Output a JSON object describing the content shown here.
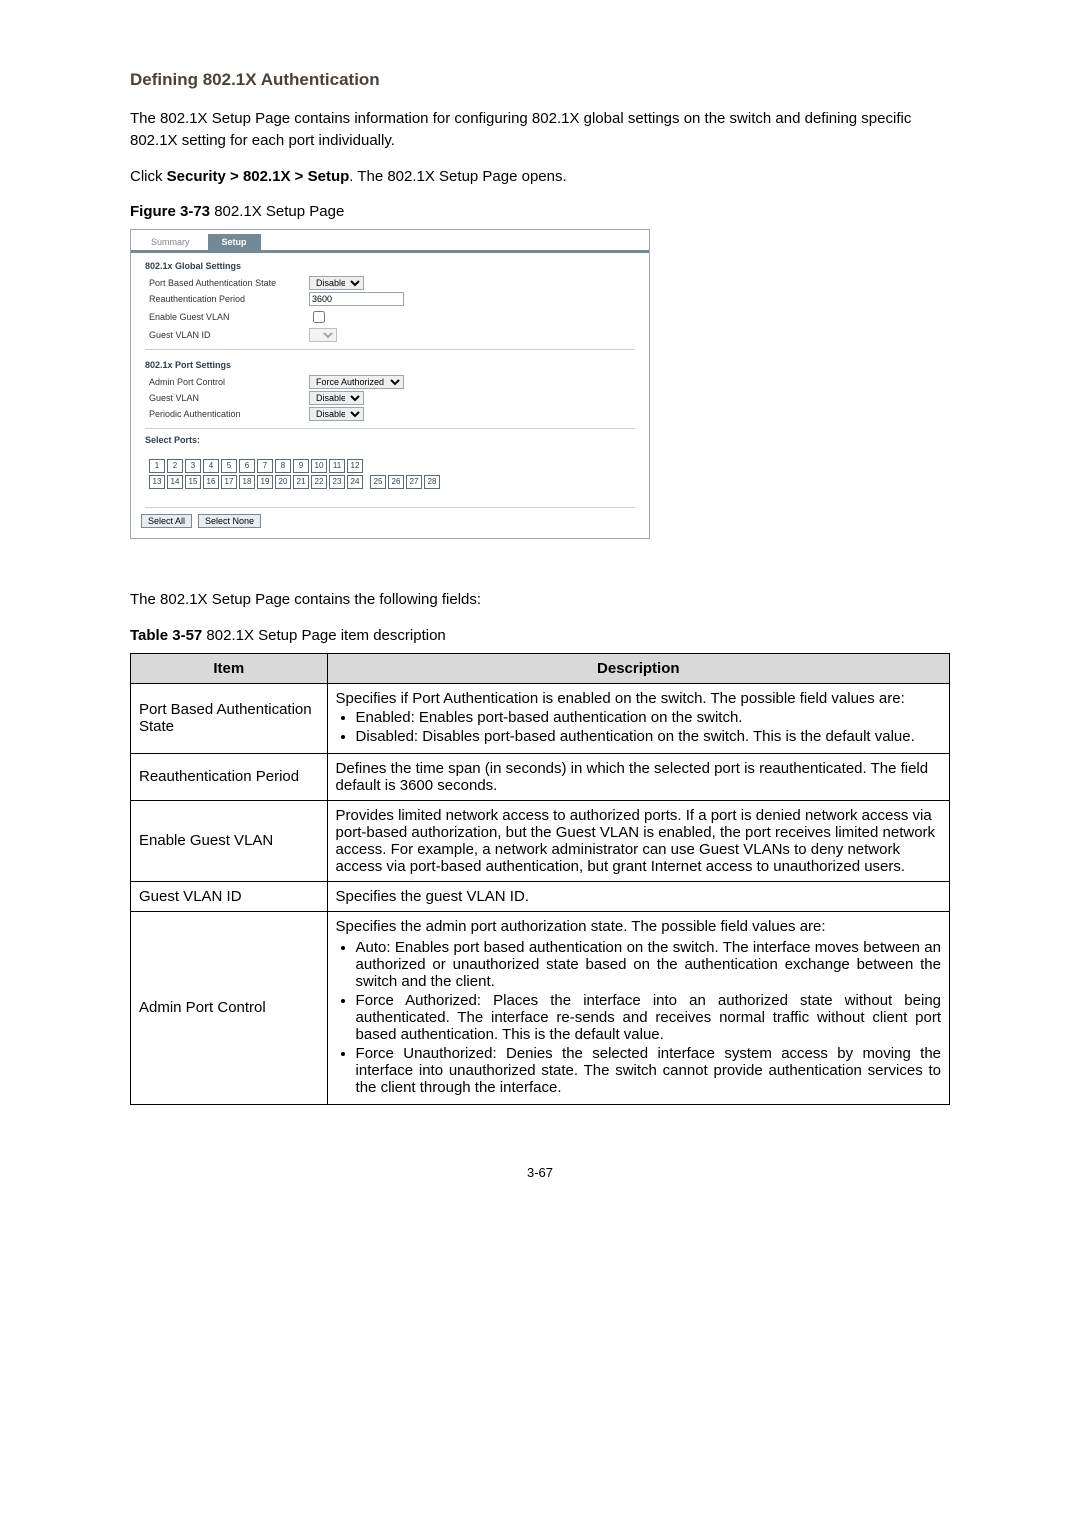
{
  "heading": "Defining 802.1X Authentication",
  "intro": "The 802.1X Setup Page contains information for configuring 802.1X global settings on the switch and defining specific 802.1X setting for each port individually.",
  "nav_sentence_prefix": "Click ",
  "nav_sentence_bold": "Security > 802.1X > Setup",
  "nav_sentence_suffix": ". The 802.1X Setup Page opens.",
  "figure_label_bold": "Figure 3-73",
  "figure_label_rest": " 802.1X Setup Page",
  "between_text": "The 802.1X Setup Page contains the following fields:",
  "table_label_bold": "Table 3-57",
  "table_label_rest": " 802.1X Setup Page item description",
  "page_number": "3-67",
  "screenshot": {
    "tabs": {
      "inactive": "Summary",
      "active": "Setup"
    },
    "global_title": "802.1x Global Settings",
    "global_fields": {
      "pbas_label": "Port Based Authentication State",
      "pbas_value": "Disabled",
      "reauth_label": "Reauthentication Period",
      "reauth_value": "3600",
      "guest_enable_label": "Enable Guest VLAN",
      "guest_id_label": "Guest VLAN ID"
    },
    "port_title": "802.1x Port Settings",
    "port_fields": {
      "admin_label": "Admin Port Control",
      "admin_value": "Force Authorized",
      "guest_vlan_label": "Guest VLAN",
      "guest_vlan_value": "Disabled",
      "periodic_label": "Periodic Authentication",
      "periodic_value": "Disabled"
    },
    "select_ports": "Select Ports:",
    "ports_top": [
      "1",
      "2",
      "3",
      "4",
      "5",
      "6",
      "7",
      "8",
      "9",
      "10",
      "11",
      "12"
    ],
    "ports_bot": [
      "13",
      "14",
      "15",
      "16",
      "17",
      "18",
      "19",
      "20",
      "21",
      "22",
      "23",
      "24",
      "25",
      "26",
      "27",
      "28"
    ],
    "btn_all": "Select All",
    "btn_none": "Select None"
  },
  "table": {
    "head_item": "Item",
    "head_desc": "Description",
    "rows": [
      {
        "item": "Port Based Authentication State",
        "desc_intro": "Specifies if Port Authentication is enabled on the switch. The possible field values are:",
        "bullets": [
          "Enabled: Enables port-based authentication on the switch.",
          "Disabled: Disables port-based authentication on the switch. This is the default value."
        ]
      },
      {
        "item": "Reauthentication Period",
        "desc_intro": "Defines the time span (in seconds) in which the selected port is reauthenticated. The field default is 3600 seconds."
      },
      {
        "item": "Enable Guest VLAN",
        "desc_intro": "Provides limited network access to authorized ports. If a port is denied network access via port-based authorization, but the Guest VLAN is enabled, the port receives limited network access. For example, a network administrator can use Guest VLANs to deny network access via port-based authentication, but grant Internet access to unauthorized users."
      },
      {
        "item": "Guest VLAN ID",
        "desc_intro": "Specifies the guest VLAN ID."
      },
      {
        "item": "Admin Port Control",
        "desc_intro": "Specifies the admin port authorization state. The possible field values are:",
        "bullets": [
          "Auto: Enables port based authentication on the switch. The interface moves between an authorized or unauthorized state based on the authentication exchange between the switch and the client.",
          "Force Authorized: Places the interface into an authorized state without being authenticated. The interface re-sends and receives normal traffic without client port based authentication. This is the default value.",
          "Force Unauthorized: Denies the selected interface system access by moving the interface into unauthorized state. The switch cannot provide authentication services to the client through the interface."
        ]
      }
    ]
  }
}
